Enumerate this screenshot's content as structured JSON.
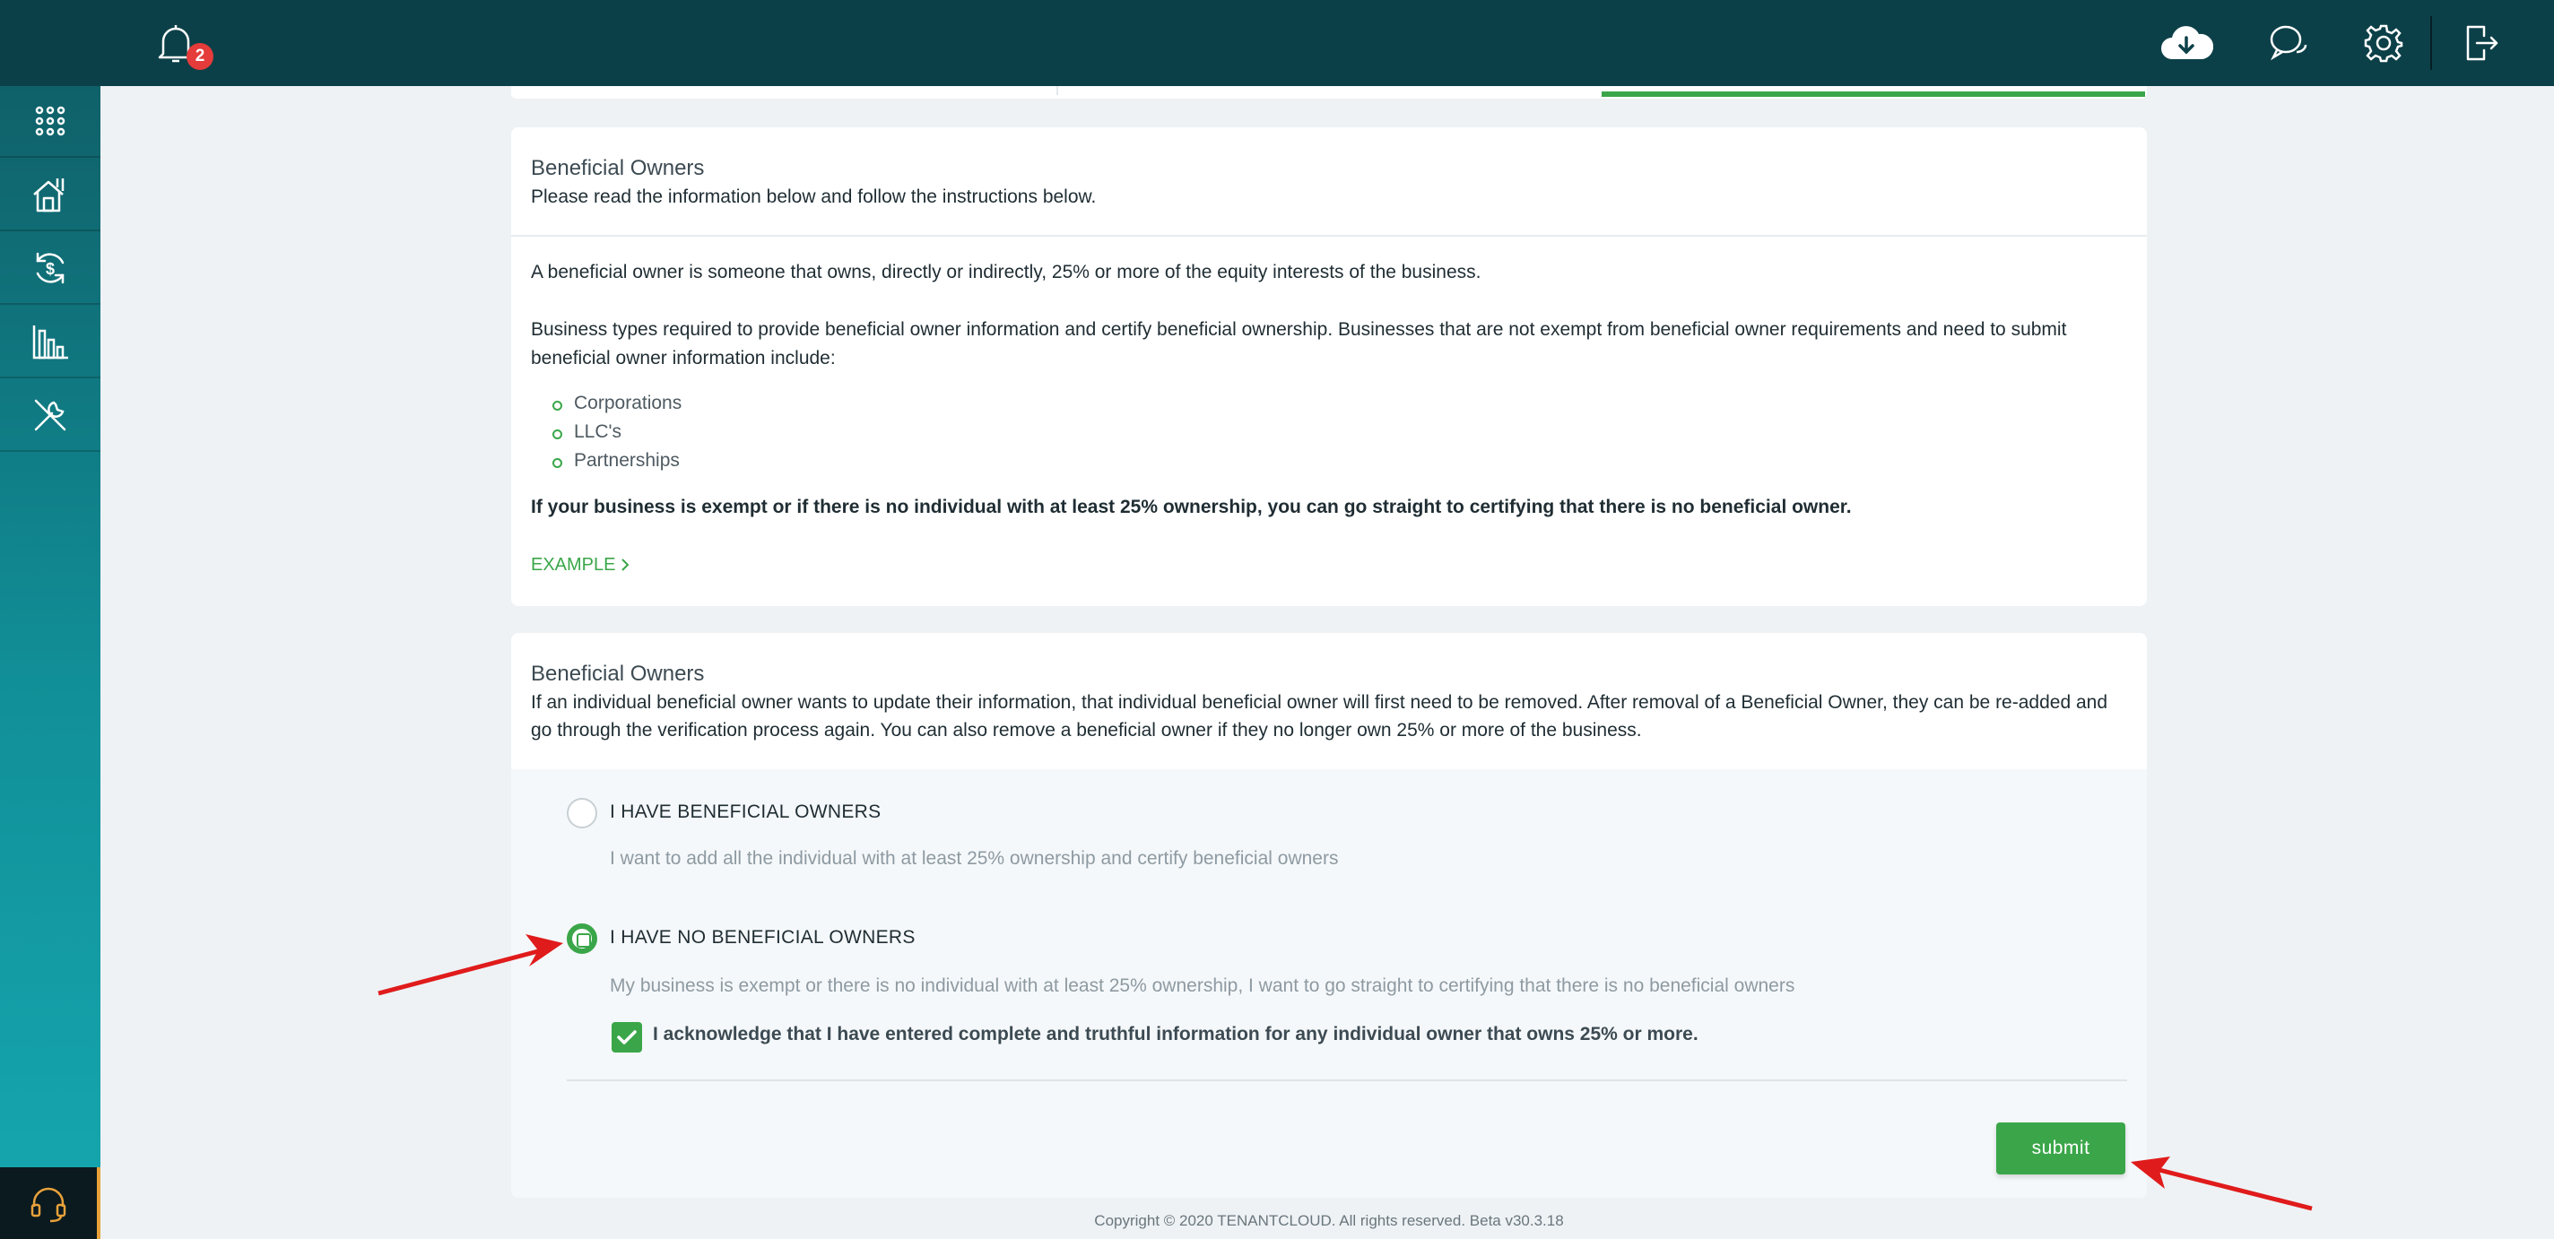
{
  "header": {
    "notification_count": "2"
  },
  "sidebar": {
    "items": [
      {
        "icon": "apps-grid-icon"
      },
      {
        "icon": "properties-house-icon"
      },
      {
        "icon": "accounting-dollar-icon"
      },
      {
        "icon": "reports-chart-icon"
      },
      {
        "icon": "maintenance-tools-icon"
      }
    ],
    "support_icon": "headset-icon"
  },
  "info_card": {
    "title": "Beneficial Owners",
    "subtitle": "Please read the information below and follow the instructions below.",
    "definition": "A beneficial owner is someone that owns, directly or indirectly, 25% or more of the equity interests of the business.",
    "requirement": "Business types required to provide beneficial owner information and certify beneficial ownership. Businesses that are not exempt from beneficial owner requirements and need to submit beneficial owner information include:",
    "business_types": [
      "Corporations",
      "LLC's",
      "Partnerships"
    ],
    "exempt_note": "If your business is exempt or if there is no individual with at least 25% ownership, you can go straight to certifying that there is no beneficial owner.",
    "example_link": "EXAMPLE"
  },
  "owners_card": {
    "title": "Beneficial Owners",
    "description": "If an individual beneficial owner wants to update their information, that individual beneficial owner will first need to be removed. After removal of a Beneficial Owner, they can be re-added and go through the verification process again. You can also remove a beneficial owner if they no longer own 25% or more of the business.",
    "option_have": {
      "label": "I HAVE BENEFICIAL OWNERS",
      "description": "I want to add all the individual with at least 25% ownership and certify beneficial owners",
      "selected": false
    },
    "option_none": {
      "label": "I HAVE NO BENEFICIAL OWNERS",
      "description": "My business is exempt or there is no individual with at least 25% ownership, I want to go straight to certifying that there is no beneficial owners",
      "selected": true
    },
    "acknowledge": {
      "label": "I acknowledge that I have entered complete and truthful information for any individual owner that owns 25% or more.",
      "checked": true
    },
    "submit_label": "submit"
  },
  "footer": {
    "copyright": "Copyright © 2020 TENANTCLOUD. All rights reserved. Beta v30.3.18"
  },
  "colors": {
    "topbar": "#0c4048",
    "accent_green": "#3aa649",
    "badge_red": "#e53b3b",
    "annotation_arrow": "#e01b1b"
  }
}
